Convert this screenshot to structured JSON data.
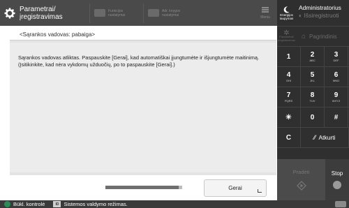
{
  "header": {
    "title_line1": "Parametrai/",
    "title_line2": "įregistravimas",
    "btn1_label": "Funkcijos nustatymai",
    "btn2_label": "Adr. knygos nustatymai",
    "menu_label": "Meniu"
  },
  "main": {
    "title": "<Sąrankos vadovas: pabaiga>",
    "message": "Sąrankos vadovas atliktas. Paspauskite [Gerai], kad automatiškai įjungtumėte ir išjungtumėte maitinimą. (Įsitikinkite, kad nėra vykdomų užduočių, po to paspauskite [Gerai].)",
    "ok_label": "Gerai",
    "progress_fraction": 0.95
  },
  "status": {
    "status_monitor_label": "Bükl. kontrolė",
    "system_mode_label": "Sistemos valdymo režimas.",
    "id_badge": "ID"
  },
  "panel": {
    "energy_label_1": "Energijos",
    "energy_label_2": "taupymas",
    "admin_name": "Administratorius",
    "logout_label": "Išsiregistruoti",
    "settings_label_1": "Parametrai/",
    "settings_label_2": "įregistravimas",
    "home_label": "Pagrindinis",
    "keys": [
      {
        "main": "1",
        "sub": ""
      },
      {
        "main": "2",
        "sub": "ABC"
      },
      {
        "main": "3",
        "sub": "DEF"
      },
      {
        "main": "4",
        "sub": "GHI"
      },
      {
        "main": "5",
        "sub": "JKL"
      },
      {
        "main": "6",
        "sub": "MNO"
      },
      {
        "main": "7",
        "sub": "PQRS"
      },
      {
        "main": "8",
        "sub": "TUV"
      },
      {
        "main": "9",
        "sub": "WXYZ"
      },
      {
        "main": "✳",
        "sub": ""
      },
      {
        "main": "0",
        "sub": ""
      },
      {
        "main": "#",
        "sub": ""
      }
    ],
    "clear_label": "C",
    "back_label": "Atkurti",
    "start_label": "Pradėti",
    "stop_label": "Stop"
  }
}
